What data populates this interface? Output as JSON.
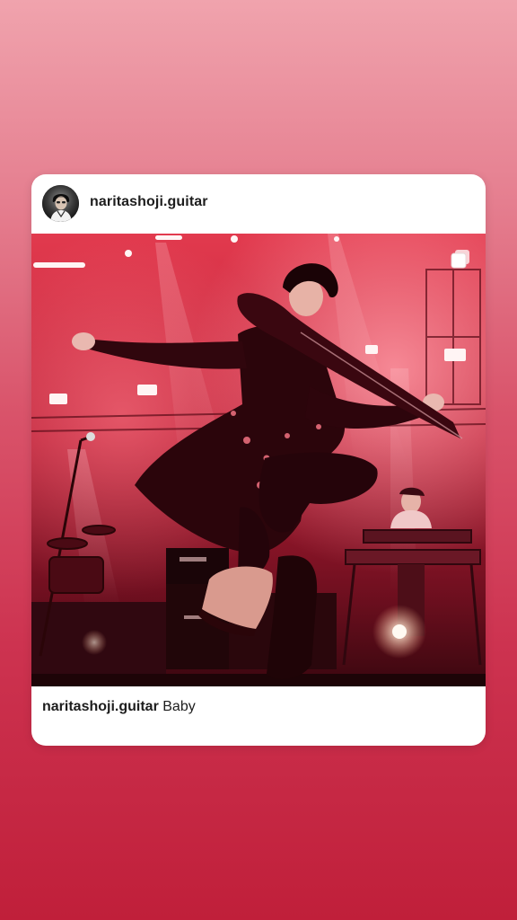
{
  "post": {
    "username": "naritashoji.guitar",
    "caption_username": "naritashoji.guitar",
    "caption_text": "Baby"
  },
  "icons": {
    "carousel": "multiple-images-icon",
    "avatar": "profile-avatar"
  },
  "colors": {
    "story_gradient_top": "#f0a3ad",
    "story_gradient_bottom": "#c01f3a",
    "card_background": "#ffffff",
    "text_primary": "#1d1d1d"
  }
}
